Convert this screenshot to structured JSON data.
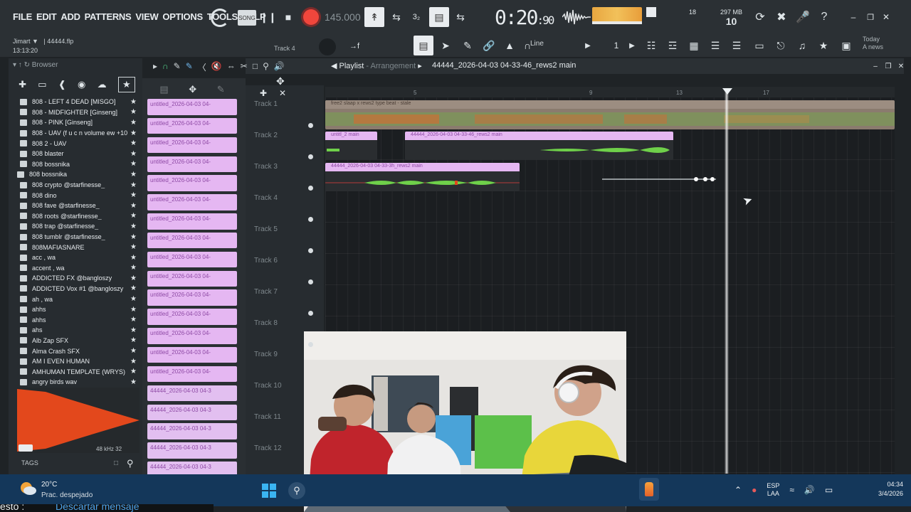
{
  "menu": [
    "FILE",
    "EDIT",
    "ADD",
    "PATTERNS",
    "VIEW",
    "OPTIONS",
    "TOOLS",
    "HELP"
  ],
  "transport": {
    "bpm": "145.000",
    "time_main": "0:20",
    "time_sub": ":90",
    "memory": "297 MB",
    "voices": "10",
    "cpu_num": "18"
  },
  "project": {
    "user": "Jimart",
    "file": "44444.flp",
    "time": "13:13:20",
    "track_hint": "Track 4"
  },
  "snap_label": "Line",
  "today_hint": [
    "Today",
    "A news"
  ],
  "browser": {
    "title": "Browser",
    "files": [
      "808 - LEFT 4 DEAD [MISGO]",
      "808 - MIDFIGHTER [Ginseng]",
      "808 - PINK [Ginseng]",
      "808 - UAV (f u c n volume ew +10]",
      "808 2 - UAV",
      "808 blaster",
      "808 bossnika",
      "808 bossnika",
      "808 crypto @starfinesse_",
      "808 dino",
      "808 fave @starfinesse_",
      "808 roots @starfinesse_",
      "808 trap @starfinesse_",
      "808 tumblr @starfinesse_",
      "808MAFIASNARE",
      "acc , wa",
      "accent , wa",
      "ADDICTED FX @bangloszy",
      "ADDICTED Vox #1 @bangloszy",
      "ah , wa",
      "ahhs",
      "ahhs",
      "ahs",
      "Alb Zap SFX",
      "Alma Crash SFX",
      "AM I EVEN HUMAN",
      "AMHUMAN TEMPLATE (WRYS)",
      "angry birds wav"
    ],
    "preview_info": "48 kHz 32",
    "tags_label": "TAGS"
  },
  "patterns": [
    "untitled_2026-04-03 04-",
    "untitled_2026-04-03 04-",
    "untitled_2026-04-03 04-",
    "untitled_2026-04-03 04-",
    "untitled_2026-04-03 04-",
    "untitled_2026-04-03 04-",
    "untitled_2026-04-03 04-",
    "untitled_2026-04-03 04-",
    "untitled_2026-04-03 04-",
    "untitled_2026-04-03 04-",
    "untitled_2026-04-03 04-",
    "untitled_2026-04-03 04-",
    "untitled_2026-04-03 04-",
    "untitled_2026-04-03 04-",
    "untitled_2026-04-03 04-",
    "44444_2026-04-03 04-3",
    "44444_2026-04-03 04-3",
    "44444_2026-04-03 04-3",
    "44444_2026-04-03 04-3",
    "44444_2026-04-03 04-3"
  ],
  "playlist": {
    "title": "Playlist",
    "subtitle": "Arrangement",
    "file": "44444_2026-04-03 04-33-46_rews2 main",
    "tracks": [
      "Track 1",
      "Track 2",
      "Track 3",
      "Track 4",
      "Track 5",
      "Track 6",
      "Track 7",
      "Track 8",
      "Track 9",
      "Track 10",
      "Track 11",
      "Track 12"
    ],
    "ruler": [
      "5",
      "9",
      "13",
      "17"
    ],
    "clips": {
      "c1": "free2 slaap x rews2 type beat - stale",
      "c2": "untitl_2 main",
      "c3": "44444_2026-04-03 04-33-46_rews2 main",
      "c4": "44444_2026-04-03 04-33-3h_rews2 main"
    }
  },
  "taskbar": {
    "temp": "20°C",
    "condition": "Prac. despejado",
    "lang1": "ESP",
    "lang2": "LAA",
    "time": "04:34",
    "date": "3/4/2026"
  },
  "chat": {
    "prefix": "esto :",
    "link": "Descartar mensaje"
  },
  "colors": {
    "pattern_clip": "#e5b7f2",
    "audio_wave": "#6fd04a",
    "record": "#f0463c",
    "taskbar": "#14375a",
    "webcam_red_shirt": "#c0242c",
    "webcam_yellow_shirt": "#e8d63a"
  }
}
